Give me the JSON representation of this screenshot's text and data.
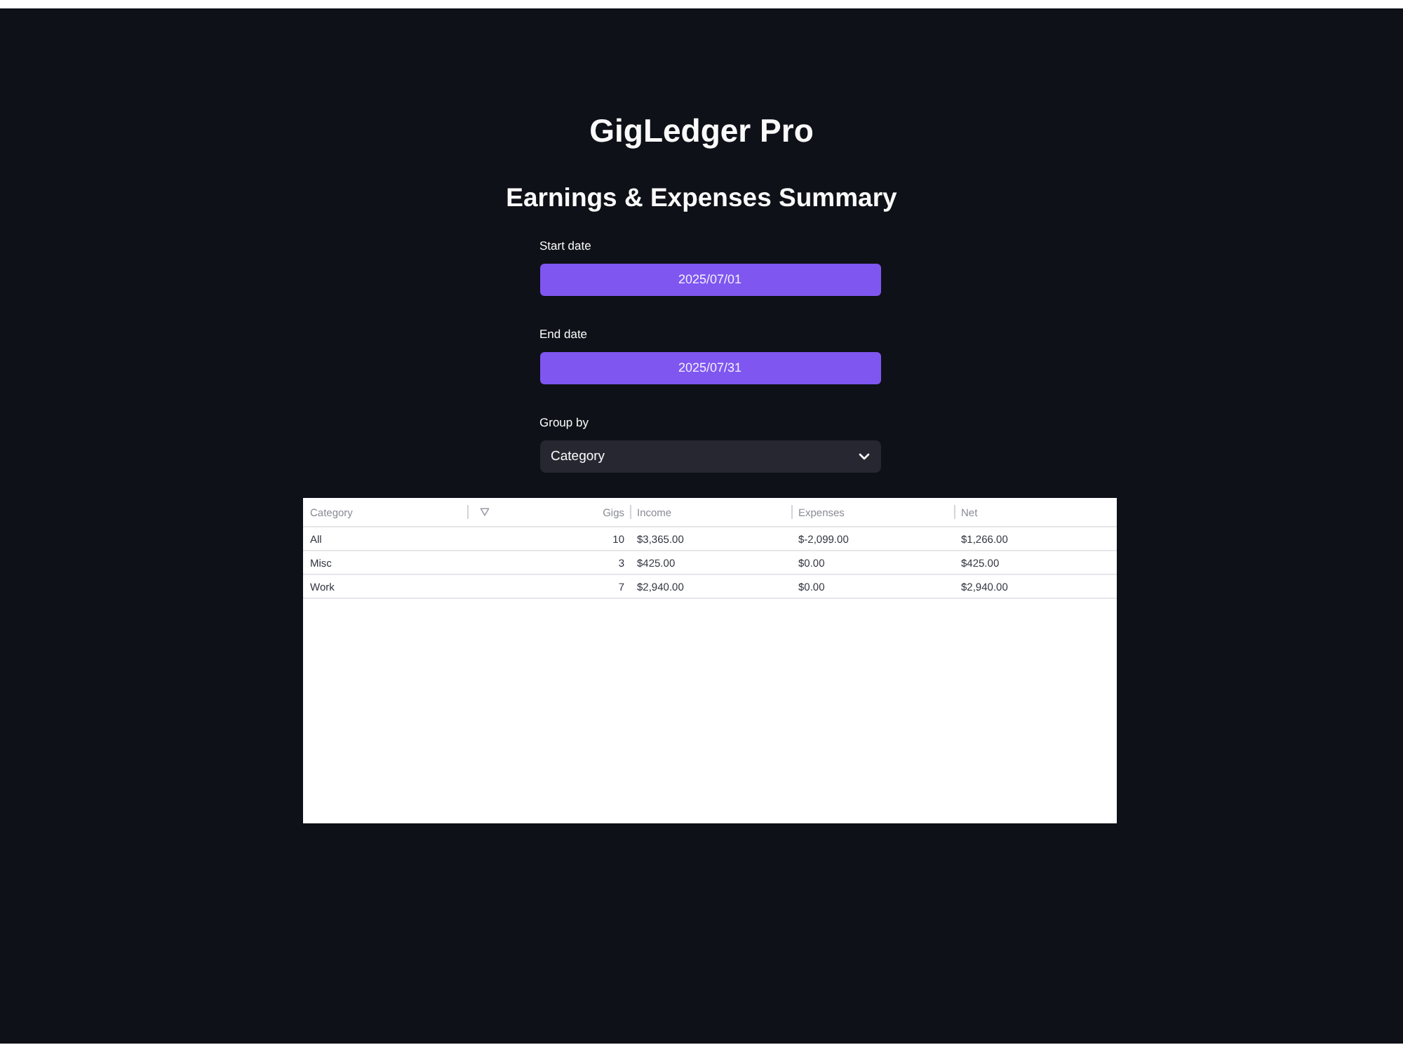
{
  "header": {
    "title": "GigLedger Pro",
    "subtitle": "Earnings & Expenses Summary"
  },
  "controls": [
    {
      "kind": "date",
      "label": "Start date",
      "value": "2025/07/01"
    },
    {
      "kind": "date",
      "label": "End date",
      "value": "2025/07/31"
    },
    {
      "kind": "select",
      "label": "Group by",
      "value": "Category"
    }
  ],
  "table": {
    "columns": [
      {
        "label": "Category",
        "kind": "text",
        "filter": false
      },
      {
        "label": "Gigs",
        "kind": "number",
        "filter": true
      },
      {
        "label": "Income",
        "kind": "text",
        "filter": false
      },
      {
        "label": "Expenses",
        "kind": "text",
        "filter": false
      },
      {
        "label": "Net",
        "kind": "text",
        "filter": false
      }
    ],
    "rows": [
      [
        "All",
        "10",
        "$3,365.00",
        "$-2,099.00",
        "$1,266.00"
      ],
      [
        "Misc",
        "3",
        "$425.00",
        "$0.00",
        "$425.00"
      ],
      [
        "Work",
        "7",
        "$2,940.00",
        "$0.00",
        "$2,940.00"
      ]
    ]
  }
}
